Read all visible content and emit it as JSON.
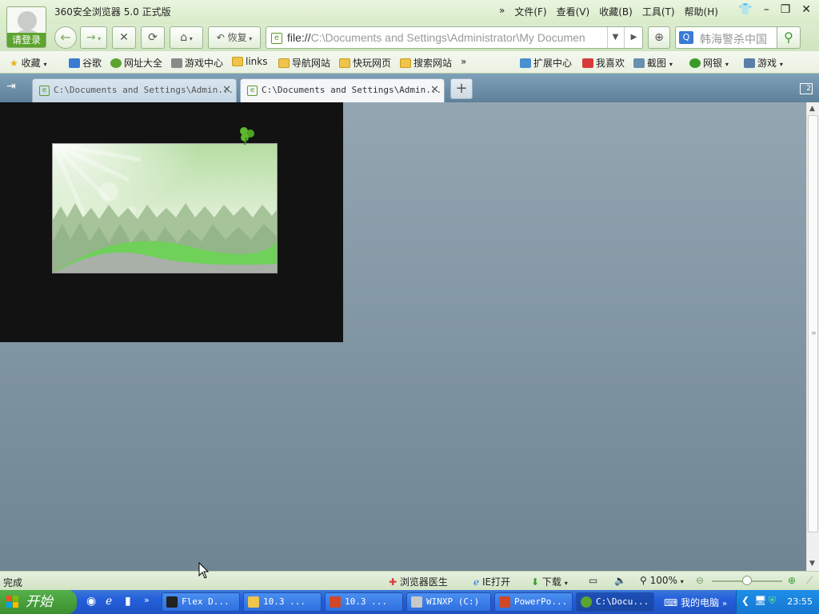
{
  "window": {
    "title": "360安全浏览器 5.0 正式版",
    "login_label": "请登录",
    "menu": [
      "文件(F)",
      "查看(V)",
      "收藏(B)",
      "工具(T)",
      "帮助(H)"
    ],
    "menu_more": "»"
  },
  "nav": {
    "restore_label": "恢复",
    "address_scheme": "file://",
    "address_rest": "C:\\Documents and Settings\\Administrator\\My Documen",
    "search_value": "韩海警杀中国"
  },
  "bookmarks": {
    "left": [
      "收藏",
      "谷歌",
      "网址大全",
      "游戏中心",
      "links",
      "导航网站",
      "快玩网页",
      "搜索网站"
    ],
    "more": "»",
    "right": [
      "扩展中心",
      "我喜欢",
      "截图",
      "网银",
      "游戏"
    ]
  },
  "tabs": [
    {
      "label": "C:\\Documents and Settings\\Admin..."
    },
    {
      "label": "C:\\Documents and Settings\\Admin..."
    }
  ],
  "tab_count": "2",
  "status": {
    "text": "完成",
    "doctor": "浏览器医生",
    "ie_open": "IE打开",
    "download": "下载",
    "zoom": "100%",
    "zoom_level": 0.5
  },
  "taskbar": {
    "start": "开始",
    "tasks": [
      "Flex D...",
      "10.3 ...",
      "10.3 ...",
      "WINXP (C:)",
      "PowerPo...",
      "C:\\Docu..."
    ],
    "my_computer": "我的电脑",
    "clock": "23:55"
  },
  "colors": {
    "accent_green": "#5ca42f",
    "taskbar_blue": "#245edb",
    "tab_bar": "#6d8fa8"
  }
}
